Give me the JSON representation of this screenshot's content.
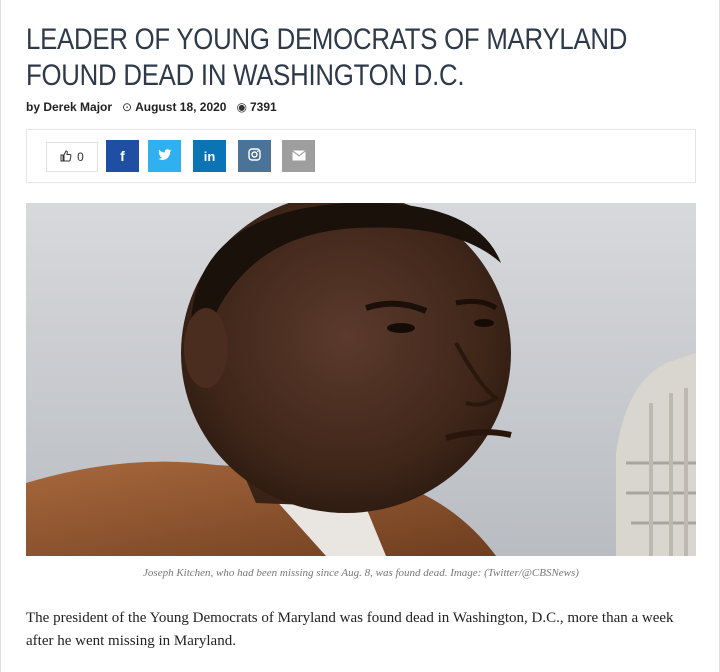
{
  "article": {
    "title": "LEADER OF YOUNG DEMOCRATS OF MARYLAND FOUND DEAD IN WASHINGTON D.C.",
    "author": "by Derek Major",
    "date": "August 18, 2020",
    "views": "7391",
    "caption": "Joseph Kitchen, who had been missing since Aug. 8, was found dead. Image: (Twitter/@CBSNews)",
    "body": "The president of the Young Democrats of Maryland was found dead in Washington, D.C., more than a week after he went missing in Maryland."
  },
  "share": {
    "like_count": "0",
    "buttons": [
      {
        "name": "facebook",
        "glyph": "f",
        "color": "#1e4fa3"
      },
      {
        "name": "twitter",
        "glyph": "t",
        "color": "#2fb0f0"
      },
      {
        "name": "linkedin",
        "glyph": "in",
        "color": "#0b74b5"
      },
      {
        "name": "instagram",
        "glyph": "◎",
        "color": "#4b7397"
      },
      {
        "name": "email",
        "glyph": "✉",
        "color": "#9e9e9e"
      }
    ]
  },
  "icons": {
    "like": "thumbs-up-icon",
    "date": "clock-icon",
    "views": "eye-icon"
  }
}
